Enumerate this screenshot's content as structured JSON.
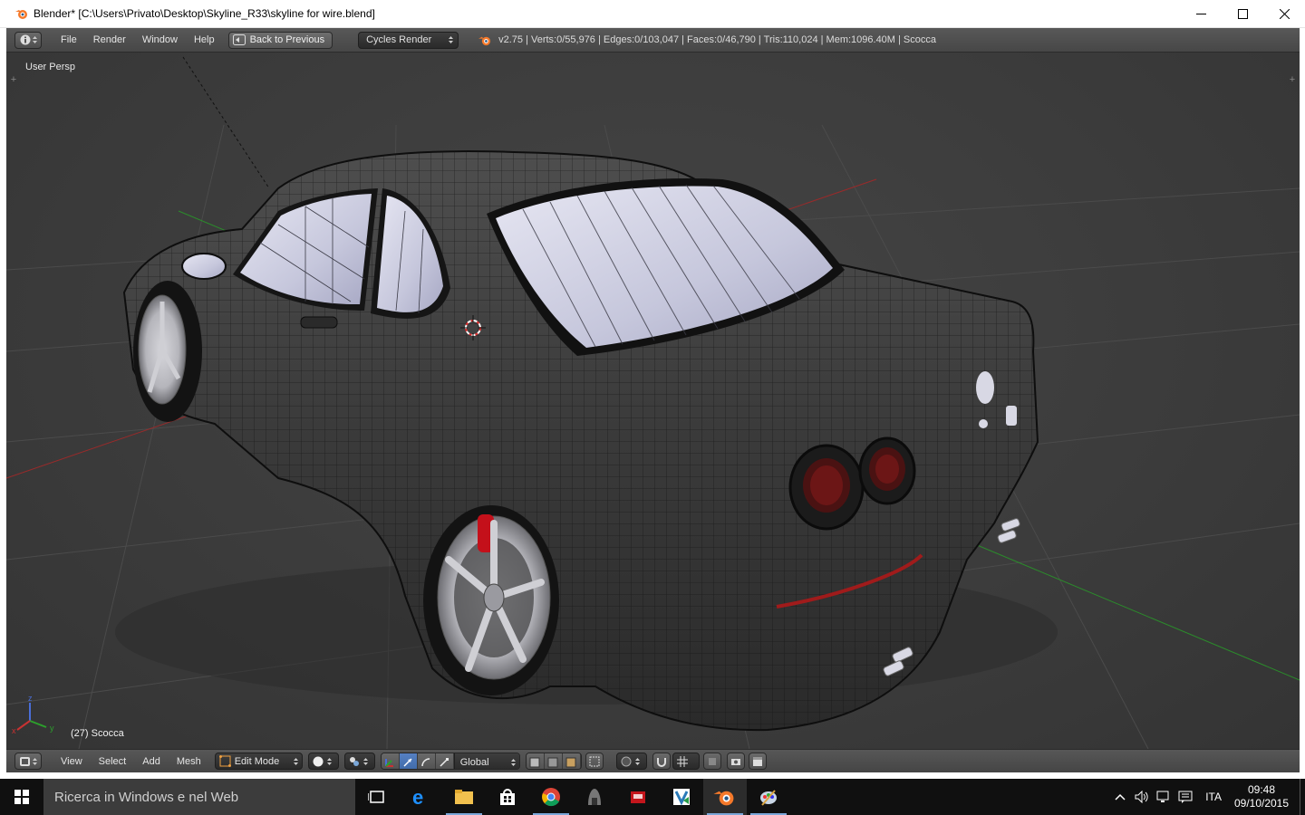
{
  "window": {
    "title": "Blender* [C:\\Users\\Privato\\Desktop\\Skyline_R33\\skyline for wire.blend]",
    "controls": [
      "minimize-icon",
      "maximize-icon",
      "close-icon"
    ]
  },
  "info_header": {
    "menus": [
      "File",
      "Render",
      "Window",
      "Help"
    ],
    "back_button": "Back to Previous",
    "render_engine": "Cycles Render",
    "stats": "v2.75 | Verts:0/55,976 | Edges:0/103,047 | Faces:0/46,790 | Tris:110,024 | Mem:1096.40M | Scocca"
  },
  "viewport": {
    "view_label": "User Persp",
    "object_label": "(27) Scocca",
    "axis_labels": {
      "x": "x",
      "y": "y",
      "z": "z"
    }
  },
  "view3d_header": {
    "menus": [
      "View",
      "Select",
      "Add",
      "Mesh"
    ],
    "mode": "Edit Mode",
    "orientation": "Global"
  },
  "taskbar": {
    "search_placeholder": "Ricerca in Windows e nel Web",
    "apps": [
      "task-view-icon",
      "edge-icon",
      "file-explorer-icon",
      "store-icon",
      "chrome-icon",
      "app-icon",
      "red-app-icon",
      "visio-icon",
      "blender-icon",
      "paint-icon"
    ],
    "language": "ITA",
    "time": "09:48",
    "date": "09/10/2015"
  },
  "colors": {
    "blender_header": "#4f4f4f",
    "viewport_bg": "#3d3d3d",
    "taskbar": "#101010",
    "accent_blue": "#5680c2",
    "x_axis": "#b03030",
    "y_axis": "#30a030"
  }
}
